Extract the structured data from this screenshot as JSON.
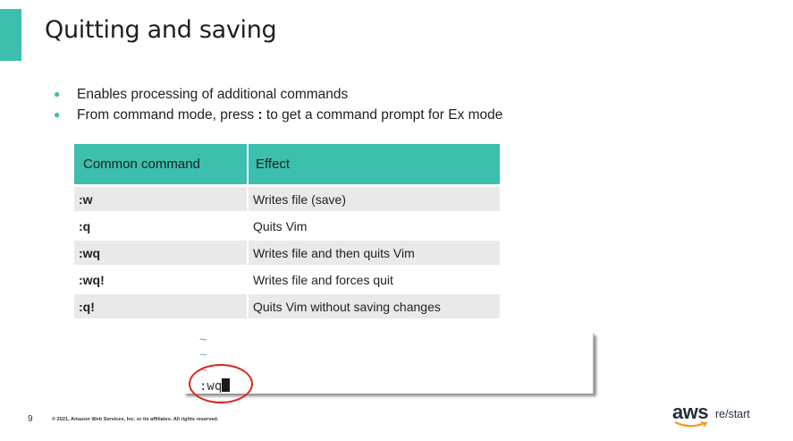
{
  "slide": {
    "title": "Quitting and saving",
    "bullets": [
      {
        "text": "Enables processing of additional commands"
      },
      {
        "pre": "From command mode, press ",
        "key": ":",
        "post": " to get a command prompt for Ex mode"
      }
    ]
  },
  "table": {
    "headers": [
      "Common command",
      "Effect"
    ],
    "rows": [
      {
        "command": ":w",
        "effect": "Writes file (save)"
      },
      {
        "command": ":q",
        "effect": "Quits Vim"
      },
      {
        "command": ":wq",
        "effect": "Writes file and then quits Vim"
      },
      {
        "command": ":wq!",
        "effect": "Writes file and forces quit"
      },
      {
        "command": ":q!",
        "effect": "Quits Vim without saving changes"
      }
    ]
  },
  "terminal": {
    "tilde": "~",
    "command": ":wq"
  },
  "footer": {
    "page_number": "9",
    "copyright": "© 2021, Amazon Web Services, Inc. or its affiliates. All rights reserved.",
    "logo_main": "aws",
    "logo_sub": "re/start"
  },
  "colors": {
    "accent": "#3cbfae",
    "row_shade": "#e9e9e9",
    "highlight_circle": "#d9261c",
    "logo_smile": "#f7981d"
  }
}
